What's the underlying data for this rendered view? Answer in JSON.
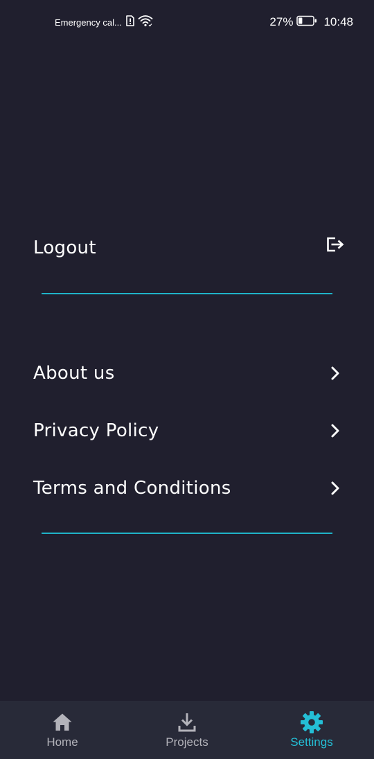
{
  "status_bar": {
    "carrier_text": "Emergency cal...",
    "battery_percent": "27%",
    "battery_level": 0.27,
    "time": "10:48"
  },
  "account_section": {
    "logout_label": "Logout",
    "logout_icon": "logout-icon"
  },
  "info_section": {
    "items": [
      {
        "label": "About us",
        "icon": "chevron-right-icon"
      },
      {
        "label": "Privacy Policy",
        "icon": "chevron-right-icon"
      },
      {
        "label": "Terms and Conditions",
        "icon": "chevron-right-icon"
      }
    ]
  },
  "bottom_nav": {
    "items": [
      {
        "label": "Home",
        "icon": "home-icon",
        "active": false
      },
      {
        "label": "Projects",
        "icon": "download-icon",
        "active": false
      },
      {
        "label": "Settings",
        "icon": "gear-icon",
        "active": true
      }
    ]
  },
  "colors": {
    "background": "#201f2e",
    "nav_background": "#282a38",
    "accent": "#24bfd6",
    "divider": "#1fb3c8",
    "inactive": "#b3b3ba"
  }
}
